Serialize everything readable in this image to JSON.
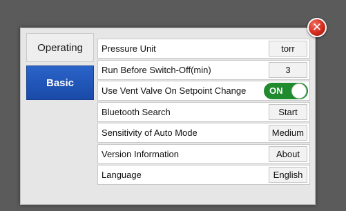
{
  "tabs": [
    {
      "label": "Operating"
    },
    {
      "label": "Basic",
      "selected": true
    }
  ],
  "close_icon": {
    "glyph": "✕",
    "icon": "close-icon",
    "color": "#d42a1c"
  },
  "settings": [
    {
      "label": "Pressure Unit",
      "value": "torr"
    },
    {
      "label": "Run Before Switch-Off(min)",
      "value": "3"
    },
    {
      "label": "Use Vent Valve On Setpoint Change",
      "toggle": "ON",
      "toggle_color": "#1f8a2e"
    },
    {
      "label": "Bluetooth Search",
      "value": "Start"
    },
    {
      "label": "Sensitivity of Auto Mode",
      "value": "Medium"
    },
    {
      "label": "Version Information",
      "value": "About"
    },
    {
      "label": "Language",
      "value": "English"
    }
  ]
}
